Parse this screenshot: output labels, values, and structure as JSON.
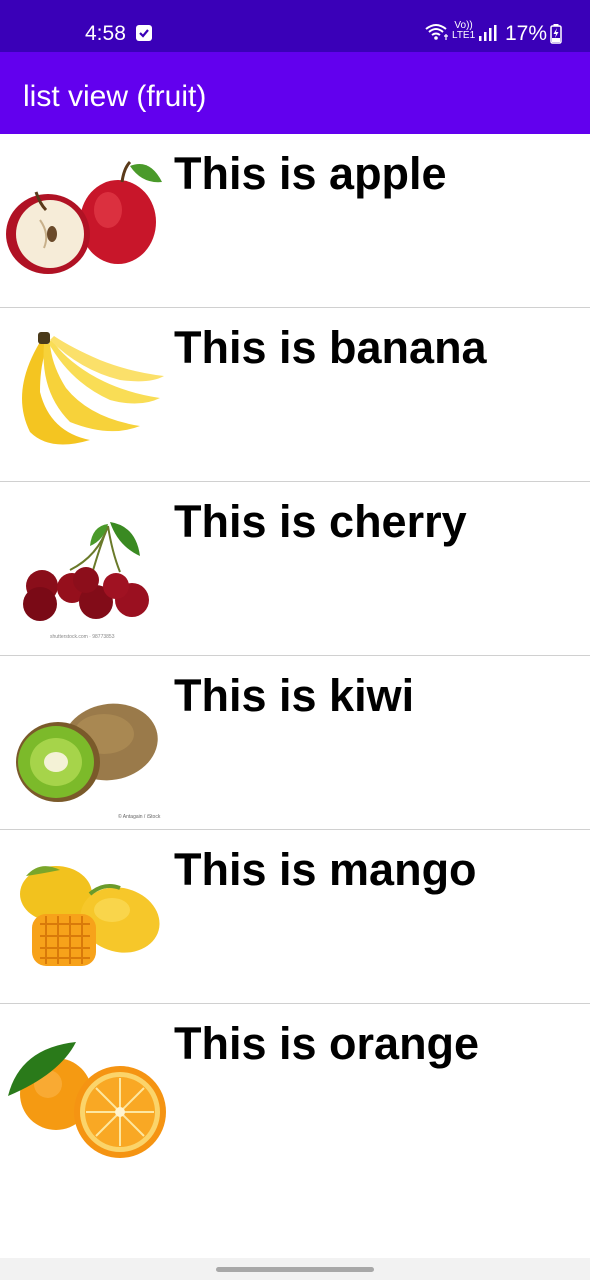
{
  "status_bar": {
    "time": "4:58",
    "network_label_top": "Vo))",
    "network_label_bottom": "LTE1",
    "battery_percent": "17%",
    "icons": [
      "notification-check-icon",
      "wifi-icon",
      "volte-icon",
      "signal-icon",
      "battery-charging-icon"
    ]
  },
  "app_bar": {
    "title": "list view (fruit)",
    "color": "#6200ee",
    "status_color": "#3a00b8"
  },
  "fruits": [
    {
      "label": "This is apple",
      "image": "apple-image"
    },
    {
      "label": "This is banana",
      "image": "banana-image"
    },
    {
      "label": "This is cherry",
      "image": "cherry-image"
    },
    {
      "label": "This is kiwi",
      "image": "kiwi-image"
    },
    {
      "label": "This is mango",
      "image": "mango-image"
    },
    {
      "label": "This is orange",
      "image": "orange-image"
    }
  ]
}
